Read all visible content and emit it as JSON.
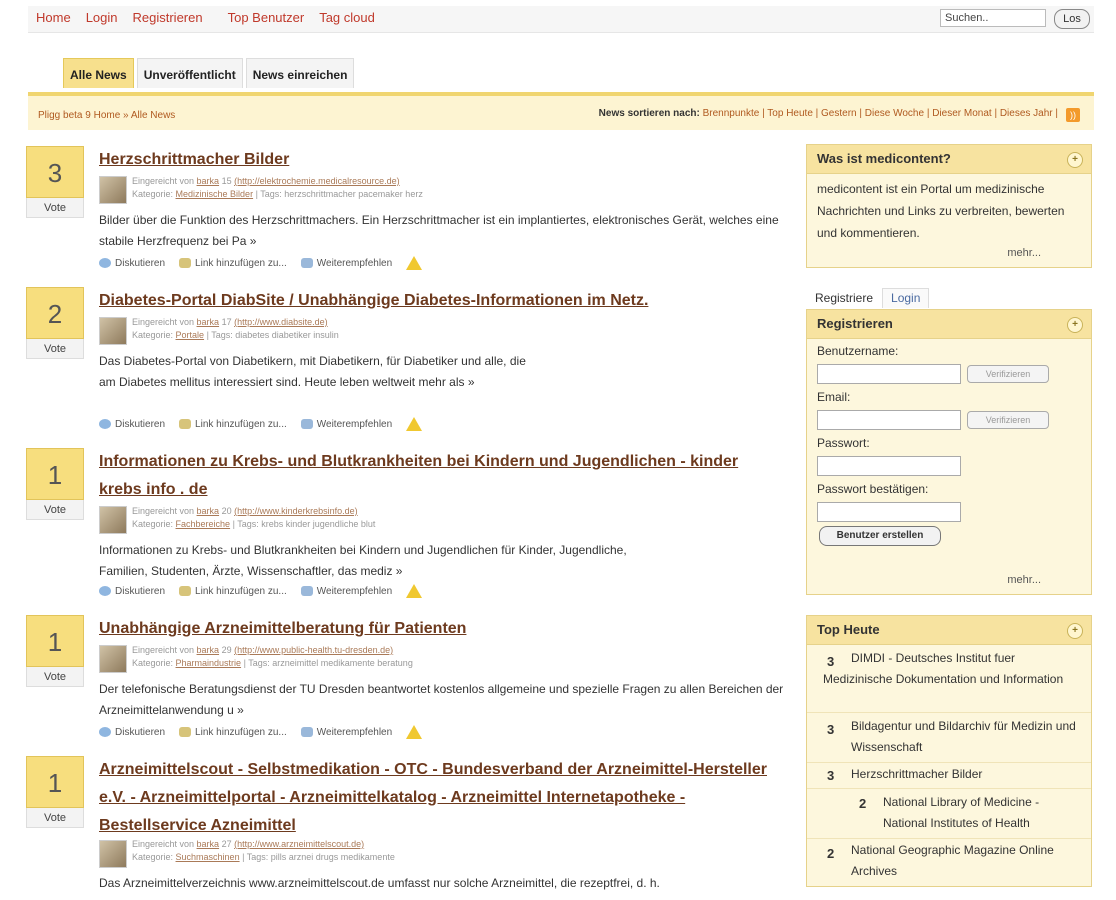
{
  "topnav": {
    "home": "Home",
    "login": "Login",
    "register": "Registrieren",
    "top_users": "Top Benutzer",
    "tag_cloud": "Tag cloud",
    "search_value": "Suchen..",
    "search_button": "Los"
  },
  "tabs": {
    "all": "Alle News",
    "unpublished": "Unveröffentlicht",
    "submit": "News einreichen"
  },
  "subbar": {
    "breadcrumb": "Pligg beta 9 Home » Alle News",
    "sort_label": "News sortieren nach:",
    "sort_options": "Brennpunkte | Top Heute | Gestern | Diese Woche | Dieser Monat | Dieses Jahr |"
  },
  "stories": [
    {
      "votes": "3",
      "vote_label": "Vote",
      "title": "Herzschrittmacher Bilder",
      "meta1": "Eingereicht von ",
      "user": "barka",
      "meta_mid": " 15 ",
      "url": "(http://elektrochemie.medicalresource.de)",
      "cat_label": "Kategorie: ",
      "category": "Medizinische Bilder",
      "tags": " | Tags: herzschrittmacher pacemaker herz",
      "desc": "Bilder über die Funktion des Herzschrittmachers. Ein Herzschrittmacher ist ein implantiertes, elektronisches Gerät, welches eine stabile Herzfrequenz bei Pa »"
    },
    {
      "votes": "2",
      "vote_label": "Vote",
      "title": "Diabetes-Portal DiabSite / Unabhängige Diabetes-Informationen im Netz.",
      "meta1": "Eingereicht von ",
      "user": "barka",
      "meta_mid": " 17 ",
      "url": "(http://www.diabsite.de)",
      "cat_label": "Kategorie: ",
      "category": "Portale",
      "tags": " | Tags: diabetes diabetiker insulin",
      "desc": "Das Diabetes-Portal von Diabetikern, mit Diabetikern, für Diabetiker und alle, die am Diabetes mellitus interessiert sind. Heute leben weltweit mehr als »"
    },
    {
      "votes": "1",
      "vote_label": "Vote",
      "title": "Informationen zu Krebs- und Blutkrankheiten bei Kindern und Jugendlichen - kinder krebs info . de",
      "meta1": "Eingereicht von ",
      "user": "barka",
      "meta_mid": " 20 ",
      "url": "(http://www.kinderkrebsinfo.de)",
      "cat_label": "Kategorie: ",
      "category": "Fachbereiche",
      "tags": " | Tags: krebs kinder jugendliche blut",
      "desc": "Informationen zu Krebs- und Blutkrankheiten bei Kindern und Jugendlichen für Kinder, Jugendliche, Familien, Studenten, Ärzte, Wissenschaftler, das mediz »"
    },
    {
      "votes": "1",
      "vote_label": "Vote",
      "title": "Unabhängige Arzneimittelberatung für Patienten",
      "meta1": "Eingereicht von ",
      "user": "barka",
      "meta_mid": " 29 ",
      "url": "(http://www.public-health.tu-dresden.de)",
      "cat_label": "Kategorie: ",
      "category": "Pharmaindustrie",
      "tags": " | Tags: arzneimittel medikamente beratung",
      "desc": "Der telefonische Beratungsdienst der TU Dresden beantwortet kostenlos allgemeine und spezielle Fragen zu allen Bereichen der Arzneimittelanwendung u »"
    },
    {
      "votes": "1",
      "vote_label": "Vote",
      "title": "Arzneimittelscout - Selbstmedikation - OTC - Bundesverband der Arzneimittel-Hersteller e.V. - Arzneimittelportal - Arzneimittelkatalog - Arzneimittel Internetapotheke - Bestellservice Azneimittel",
      "meta1": "Eingereicht von ",
      "user": "barka",
      "meta_mid": " 27 ",
      "url": "(http://www.arzneimittelscout.de)",
      "cat_label": "Kategorie: ",
      "category": "Suchmaschinen",
      "tags": " | Tags: pills arznei drugs medikamente",
      "desc": "Das Arzneimittelverzeichnis www.arzneimittelscout.de umfasst nur solche Arzneimittel, die rezeptfrei, d. h."
    }
  ],
  "actions": {
    "discuss": "Diskutieren",
    "add_link": "Link hinzufügen zu...",
    "recommend": "Weiterempfehlen"
  },
  "about": {
    "title": "Was ist medicontent?",
    "text": "medicontent ist ein Portal um medizinische Nachrichten und Links zu verbreiten, bewerten und kommentieren.",
    "more": "mehr..."
  },
  "sidetabs": {
    "register": "Registriere",
    "login": "Login"
  },
  "register": {
    "title": "Registrieren",
    "username": "Benutzername:",
    "email": "Email:",
    "password": "Passwort:",
    "confirm": "Passwort bestätigen:",
    "verify": "Verifizieren",
    "create": "Benutzer erstellen",
    "more": "mehr..."
  },
  "top_today": {
    "title": "Top Heute",
    "items": [
      {
        "votes": "3",
        "text": "DIMDI - Deutsches Institut fuer Medizinische Dokumentation und Information"
      },
      {
        "votes": "3",
        "text": "Bildagentur und Bildarchiv für Medizin und Wissenschaft"
      },
      {
        "votes": "3",
        "text": "Herzschrittmacher Bilder"
      },
      {
        "votes": "2",
        "text": "National Library of Medicine - National Institutes of Health"
      },
      {
        "votes": "2",
        "text": "National Geographic Magazine Online Archives"
      }
    ]
  }
}
